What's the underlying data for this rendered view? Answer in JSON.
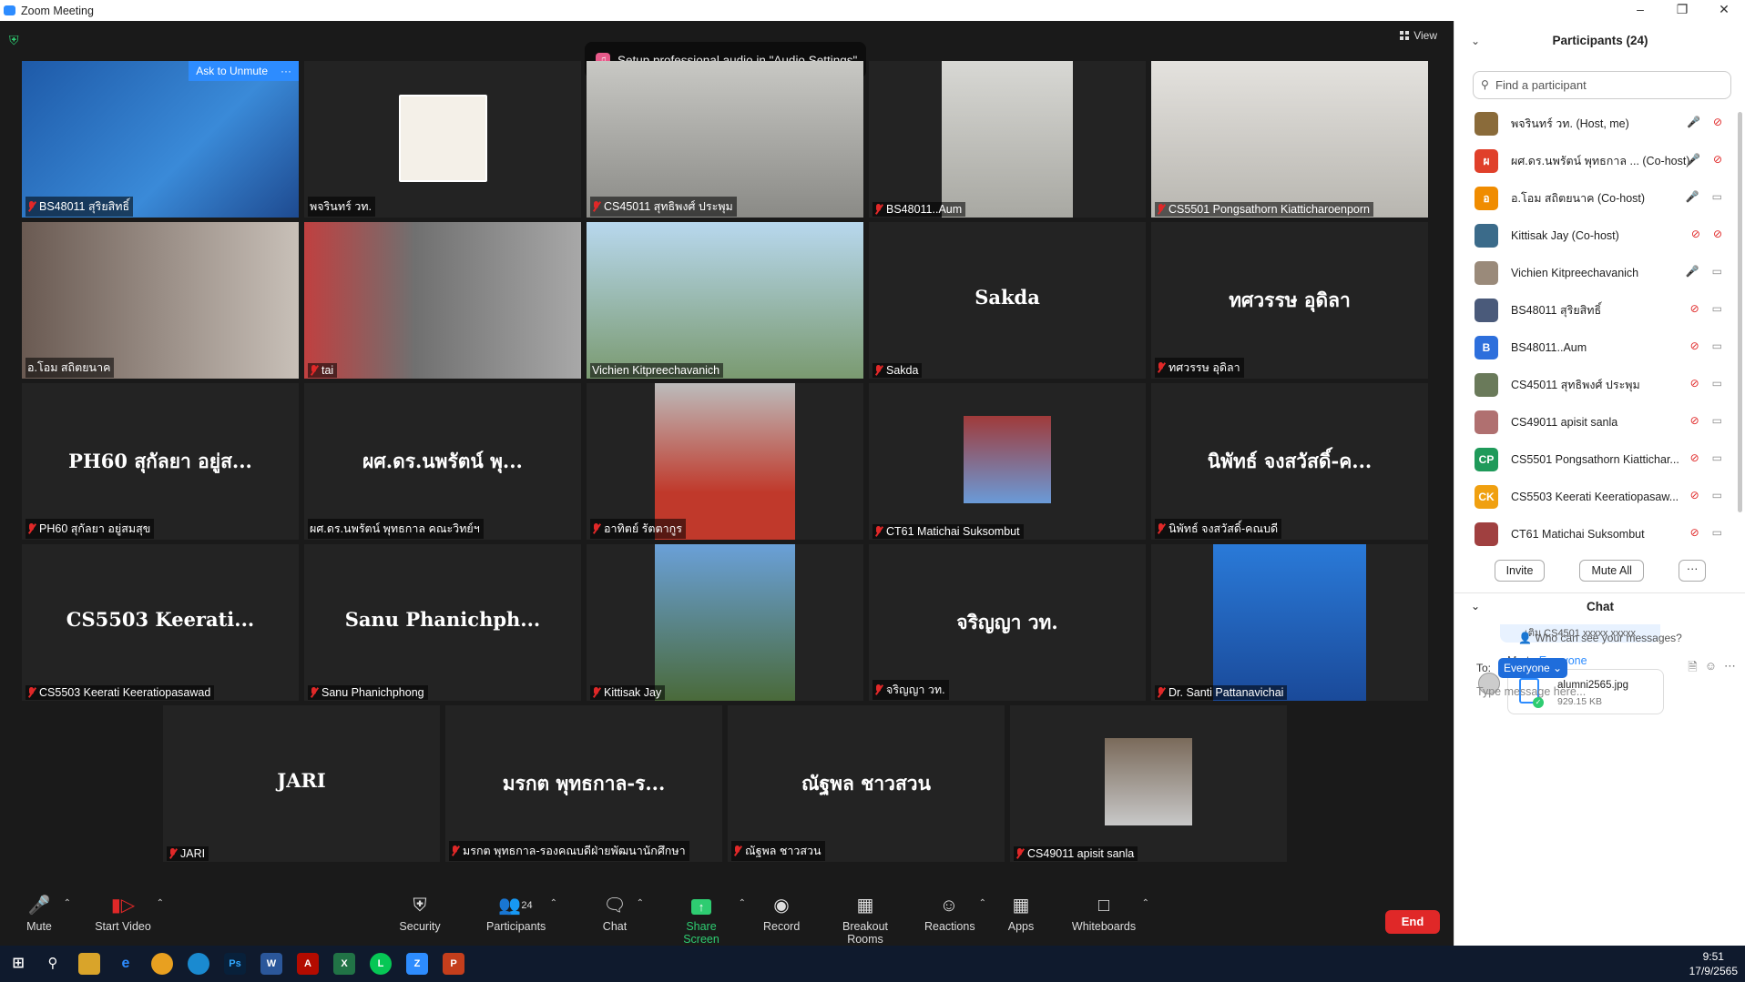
{
  "window": {
    "title": "Zoom Meeting"
  },
  "toast": {
    "prefix": "Setup professional audio in ",
    "link": "\"Audio Settings\""
  },
  "view_label": "View",
  "tiles": [
    {
      "name": "BS48011 สุริยสิทธิ์",
      "muted": true,
      "ask": "Ask to Unmute",
      "more": "···"
    },
    {
      "name": "พจรินทร์ วท.",
      "muted": false
    },
    {
      "name": "CS45011 สุทธิพงศ์ ประพุม",
      "muted": true
    },
    {
      "name": "BS48011..Aum",
      "muted": true
    },
    {
      "name": "CS5501 Pongsathorn Kiatticharoenporn",
      "muted": true
    },
    {
      "name": "อ.โอม สถิตยนาค",
      "muted": false
    },
    {
      "name": "tai",
      "muted": true
    },
    {
      "name": "Vichien Kitpreechavanich",
      "muted": false
    },
    {
      "name": "Sakda",
      "big": "Sakda",
      "muted": true
    },
    {
      "name": "ทศวรรษ อุดิลา",
      "big": "ทศวรรษ อุดิลา",
      "muted": true
    },
    {
      "name": "PH60 สุกัลยา อยู่สมสุข",
      "big": "PH60 สุกัลยา อยู่ส...",
      "muted": true
    },
    {
      "name": "ผศ.ดร.นพรัตน์ พุทธกาล คณะวิทย์ฯ",
      "big": "ผศ.ดร.นพรัตน์ พุ...",
      "muted": false
    },
    {
      "name": "อาทิตย์ รัตตากูร",
      "muted": true
    },
    {
      "name": "CT61 Matichai Suksombut",
      "muted": true
    },
    {
      "name": "นิพัทธ์ จงสวัสดิ์-คณบดี",
      "big": "นิพัทธ์ จงสวัสดิ์-ค...",
      "muted": true
    },
    {
      "name": "CS5503 Keerati Keeratiopasawad",
      "big": "CS5503 Keerati...",
      "muted": true
    },
    {
      "name": "Sanu Phanichphong",
      "big": "Sanu Phanichph...",
      "muted": true
    },
    {
      "name": "Kittisak Jay",
      "muted": true
    },
    {
      "name": "จริญญา วท.",
      "big": "จริญญา วท.",
      "muted": true
    },
    {
      "name": "Dr. Santi Pattanavichai",
      "muted": true
    },
    {
      "name": "JARI",
      "big": "JARI",
      "muted": true
    },
    {
      "name": "มรกต พุทธกาล-รองคณบดีฝ่ายพัฒนานักศึกษา",
      "big": "มรกต พุทธกาล-ร...",
      "muted": true
    },
    {
      "name": "ณัฐพล ชาวสวน",
      "big": "ณัฐพล ชาวสวน",
      "muted": true
    },
    {
      "name": "CS49011 apisit sanla",
      "muted": true
    }
  ],
  "toolbar": {
    "mute": "Mute",
    "start_video": "Start Video",
    "security": "Security",
    "participants": "Participants",
    "participants_count": "24",
    "chat": "Chat",
    "share_screen": "Share Screen",
    "record": "Record",
    "breakout": "Breakout Rooms",
    "reactions": "Reactions",
    "apps": "Apps",
    "whiteboards": "Whiteboards",
    "end": "End"
  },
  "panel": {
    "title": "Participants (24)",
    "find_placeholder": "Find a participant",
    "participants": [
      {
        "name": "พจรินทร์ วท. (Host, me)",
        "av": "",
        "color": "#8a6b3a"
      },
      {
        "name": "ผศ.ดร.นพรัตน์ พุทธกาล ... (Co-host)",
        "av": "ผ",
        "color": "#e0402a"
      },
      {
        "name": "อ.โอม สถิตยนาค (Co-host)",
        "av": "อ",
        "color": "#f08c00"
      },
      {
        "name": "Kittisak Jay (Co-host)",
        "av": "",
        "color": "#3b6b8a"
      },
      {
        "name": "Vichien Kitpreechavanich",
        "av": "",
        "color": "#9a8a7a"
      },
      {
        "name": "BS48011 สุริยสิทธิ์",
        "av": "",
        "color": "#4a5a7a"
      },
      {
        "name": "BS48011..Aum",
        "av": "B",
        "color": "#2d6fdc"
      },
      {
        "name": "CS45011 สุทธิพงศ์ ประพุม",
        "av": "",
        "color": "#6a7a5a"
      },
      {
        "name": "CS49011 apisit sanla",
        "av": "",
        "color": "#b07070"
      },
      {
        "name": "CS5501 Pongsathorn Kiattichar...",
        "av": "CP",
        "color": "#1f9a5a"
      },
      {
        "name": "CS5503 Keerati Keeratiopasaw...",
        "av": "CK",
        "color": "#f0a010"
      },
      {
        "name": "CT61 Matichai Suksombut",
        "av": "",
        "color": "#a04040"
      }
    ],
    "invite": "Invite",
    "mute_all": "Mute All",
    "more": "···",
    "chat_title": "Chat",
    "prev_msg": "เติม CS4501 xxxxx xxxxx",
    "me_to": "Me to ",
    "everyone_link": "Everyone",
    "file_name": "alumni2565.jpg",
    "file_size": "929.15 KB",
    "who_can_see": "Who can see your messages?",
    "to_label": "To:",
    "to_value": "Everyone",
    "type_placeholder": "Type message here..."
  },
  "taskbar": {
    "time": "9:51",
    "date": "17/9/2565"
  }
}
